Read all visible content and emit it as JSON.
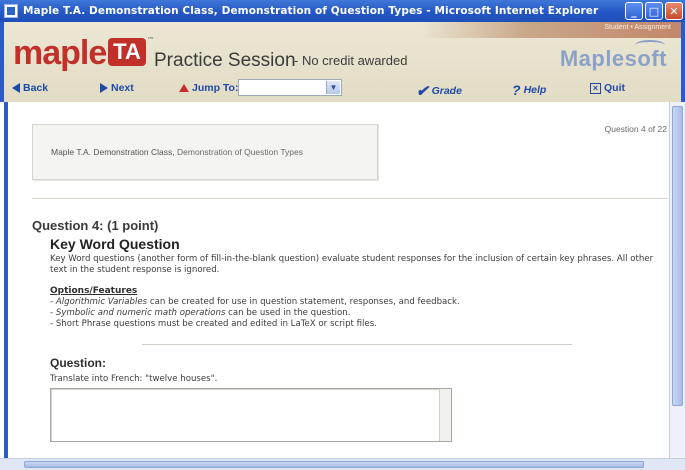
{
  "window": {
    "title": "Maple T.A. Demonstration Class, Demonstration of Question Types - Microsoft Internet Explorer",
    "buttons": {
      "minimize": "_",
      "maximize": "□",
      "close": "✕"
    }
  },
  "header": {
    "logo_main": "maple",
    "logo_badge": "TA",
    "logo_tm": "™",
    "session_title": "Practice Session",
    "session_subtitle": "- No credit awarded",
    "brand": "Maplesoft",
    "stripe_text": "Student • Assignment"
  },
  "nav": {
    "back": "Back",
    "next": "Next",
    "jump_to": "Jump To:",
    "jump_value": "",
    "grade": "Grade",
    "help": "Help",
    "quit": "Quit"
  },
  "banner": {
    "class_name": "Maple T.A. Demonstration Class,",
    "assignment": "Demonstration of Question Types"
  },
  "question_counter": "Question 4 of 22",
  "question": {
    "heading": "Question 4: (1 point)",
    "title": "Key Word Question",
    "description": "Key Word questions (another form of fill-in-the-blank question) evaluate student responses for the inclusion of certain key phrases. All other text in the student response is ignored.",
    "options_title": "Options/Features",
    "options": [
      {
        "em": "Algorithmic Variables",
        "rest": " can be created for use in question statement, responses, and feedback."
      },
      {
        "em": "Symbolic and numeric math operations",
        "rest": " can be used in the question."
      },
      {
        "em": "",
        "rest": "Short Phrase questions must be created and edited in LaTeX or script files."
      }
    ],
    "label": "Question:",
    "prompt": "Translate into French: \"twelve houses\".",
    "answer_value": ""
  },
  "colors": {
    "title_bar": "#2457c5",
    "brand_red": "#c2302a",
    "nav_blue": "#1f49a8",
    "header_bg": "#e2dcc5"
  }
}
